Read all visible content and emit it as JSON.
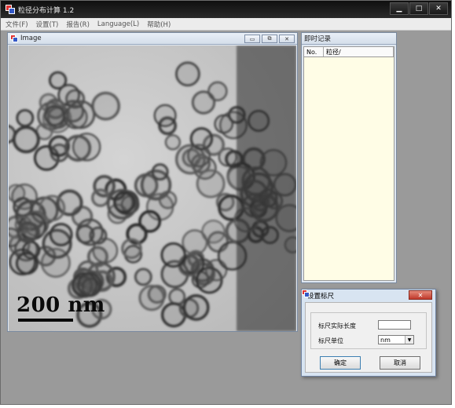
{
  "app": {
    "title": "粒径分布计算 1.2",
    "controls": {
      "minimize": "▁",
      "maximize": "□",
      "close": "✕"
    }
  },
  "menu": [
    {
      "label": "文件(F)"
    },
    {
      "label": "设置(T)"
    },
    {
      "label": "报告(R)"
    },
    {
      "label": "Language(L)"
    },
    {
      "label": "帮助(H)"
    }
  ],
  "image_window": {
    "title": "Image",
    "controls": {
      "minimize": "▭",
      "restore": "⧉",
      "close": "✕"
    },
    "scale_text": "200 nm"
  },
  "record_window": {
    "title": "即时记录",
    "columns": [
      {
        "label": "No."
      },
      {
        "label": "粒径/"
      }
    ]
  },
  "dialog": {
    "title": "设置标尺",
    "close": "✕",
    "length_label": "标尺实际长度",
    "length_value": "",
    "unit_label": "标尺单位",
    "unit_value": "nm",
    "ok": "确定",
    "cancel": "取消"
  },
  "colors": {
    "titlebar": "#1a1a1a",
    "list_background": "#fffde6",
    "dialog_close": "#c0392b"
  }
}
